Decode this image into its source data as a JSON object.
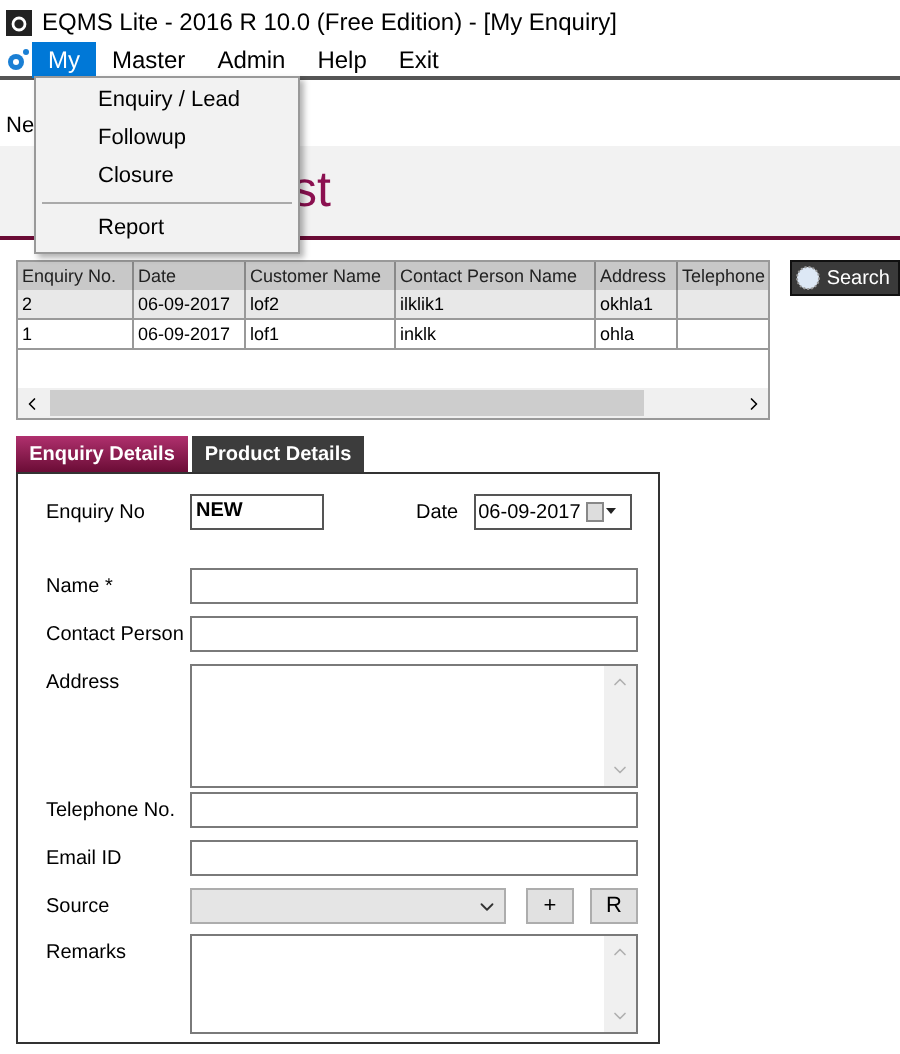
{
  "window": {
    "title": "EQMS Lite - 2016 R 10.0 (Free Edition)  - [My Enquiry]"
  },
  "menu_bar": [
    {
      "label": "My",
      "selected": true
    },
    {
      "label": "Master",
      "selected": false
    },
    {
      "label": "Admin",
      "selected": false
    },
    {
      "label": "Help",
      "selected": false
    },
    {
      "label": "Exit",
      "selected": false
    }
  ],
  "dropdown_menu": [
    {
      "kind": "item",
      "label": "Enquiry / Lead"
    },
    {
      "kind": "item",
      "label": "Followup"
    },
    {
      "kind": "item",
      "label": "Closure"
    },
    {
      "kind": "separator"
    },
    {
      "kind": "item",
      "label": "Report"
    }
  ],
  "toolbar": {
    "button_label": "Ne"
  },
  "page_heading": "st",
  "table": {
    "columns": [
      "Enquiry No.",
      "Date",
      "Customer Name",
      "Contact Person Name",
      "Address",
      "Telephone"
    ],
    "rows": [
      {
        "selected": true,
        "cells": [
          "2",
          "06-09-2017",
          "lof2",
          "ilklik1",
          "okhla1",
          ""
        ]
      },
      {
        "selected": false,
        "cells": [
          "1",
          "06-09-2017",
          "lof1",
          "inklk",
          "ohla",
          ""
        ]
      }
    ]
  },
  "search_button": "Search",
  "tabs": [
    {
      "label": "Enquiry Details",
      "selected": true
    },
    {
      "label": "Product Details",
      "selected": false
    }
  ],
  "form": {
    "enquiry_no_label": "Enquiry No",
    "enquiry_no": "NEW",
    "date_label": "Date",
    "date": "06-09-2017",
    "fields": [
      {
        "kind": "text",
        "label": "Name *"
      },
      {
        "kind": "text",
        "label": "Contact Person"
      },
      {
        "kind": "textarea",
        "label": "Address"
      },
      {
        "kind": "text",
        "label": "Telephone No."
      },
      {
        "kind": "text",
        "label": "Email ID"
      },
      {
        "kind": "select",
        "label": "Source",
        "buttons": [
          "+",
          "R"
        ]
      },
      {
        "kind": "textarea",
        "label": "Remarks"
      }
    ]
  }
}
